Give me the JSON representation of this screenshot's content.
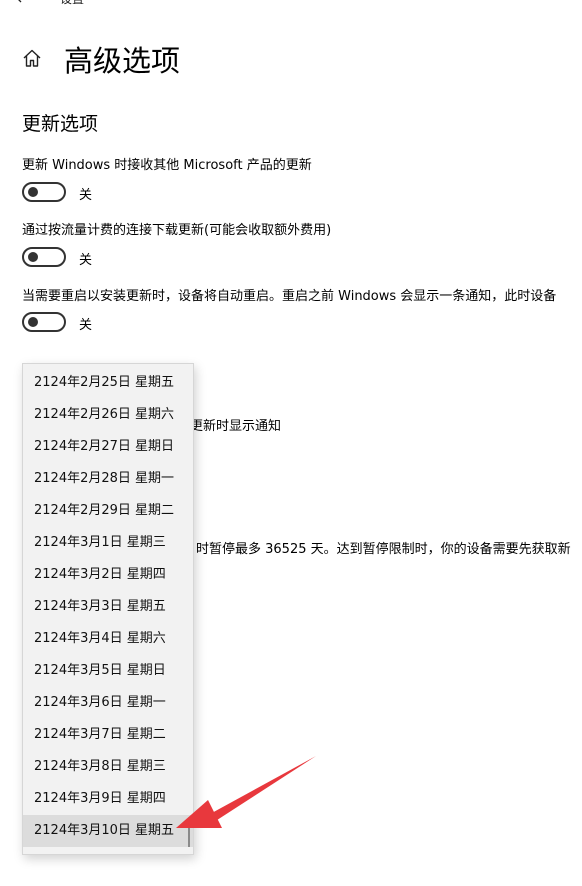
{
  "header": {
    "title": "设置",
    "page_title": "高级选项"
  },
  "section": {
    "title": "更新选项"
  },
  "options": [
    {
      "label": "更新 Windows 时接收其他 Microsoft 产品的更新",
      "state": "关"
    },
    {
      "label": "通过按流量计费的连接下载更新(可能会收取额外费用)",
      "state": "关"
    },
    {
      "label": "当需要重启以安装更新时，设备将自动重启。重启之前 Windows 会显示一条通知，此时设备",
      "state": "关"
    }
  ],
  "background_text": {
    "notify_fragment": "更新时显示通知",
    "pause_fragment": "时暂停最多 36525 天。达到暂停限制时，你的设备需要先获取新"
  },
  "dropdown": {
    "items": [
      "2124年2月25日 星期五",
      "2124年2月26日 星期六",
      "2124年2月27日 星期日",
      "2124年2月28日 星期一",
      "2124年2月29日 星期二",
      "2124年3月1日 星期三",
      "2124年3月2日 星期四",
      "2124年3月3日 星期五",
      "2124年3月4日 星期六",
      "2124年3月5日 星期日",
      "2124年3月6日 星期一",
      "2124年3月7日 星期二",
      "2124年3月8日 星期三",
      "2124年3月9日 星期四",
      "2124年3月10日 星期五"
    ],
    "selected_index": 14
  },
  "colors": {
    "arrow": "#e8383d",
    "dropdown_bg": "#f2f2f2",
    "selected_bg": "#dcdcdc"
  },
  "icons": [
    "back-arrow-icon",
    "home-icon"
  ]
}
